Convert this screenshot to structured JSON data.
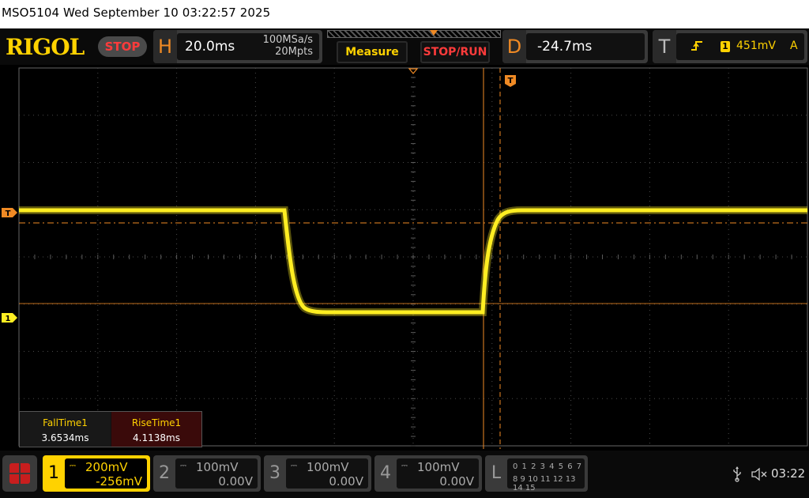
{
  "title_bar": {
    "text": "MSO5104  Wed September 10 03:22:57 2025"
  },
  "header": {
    "logo": "RIGOL",
    "run_state": "STOP",
    "horizontal": {
      "letter": "H",
      "timebase": "20.0ms",
      "sample_rate": "100MSa/s",
      "memory_depth": "20Mpts"
    },
    "measure_button": "Measure",
    "stop_run_button": "STOP/RUN",
    "delay": {
      "letter": "D",
      "value": "-24.7ms"
    },
    "trigger": {
      "letter": "T",
      "source": "1",
      "level": "451mV",
      "mode": "A"
    }
  },
  "plot": {
    "trigger_marker": "T",
    "channel1_marker": "1",
    "cursor_marker": "T",
    "colors": {
      "trace": "#ffee22",
      "grid": "#4a4a4a",
      "cursor": "#f08a24",
      "background": "#000000"
    }
  },
  "measurements": [
    {
      "label": "FallTime1",
      "value": "3.6534ms"
    },
    {
      "label": "RiseTime1",
      "value": "4.1138ms"
    }
  ],
  "channels": [
    {
      "num": "1",
      "coupling": "DC",
      "scale": "200mV",
      "offset": "-256mV",
      "active": true
    },
    {
      "num": "2",
      "coupling": "DC",
      "scale": "100mV",
      "offset": "0.00V",
      "active": false
    },
    {
      "num": "3",
      "coupling": "DC",
      "scale": "100mV",
      "offset": "0.00V",
      "active": false
    },
    {
      "num": "4",
      "coupling": "DC",
      "scale": "100mV",
      "offset": "0.00V",
      "active": false
    }
  ],
  "logic": {
    "letter": "L",
    "row1": "0 1 2 3  4 5 6 7",
    "row2": "8 9 10 11 12 13 14 15"
  },
  "status": {
    "time": "03:22"
  }
}
